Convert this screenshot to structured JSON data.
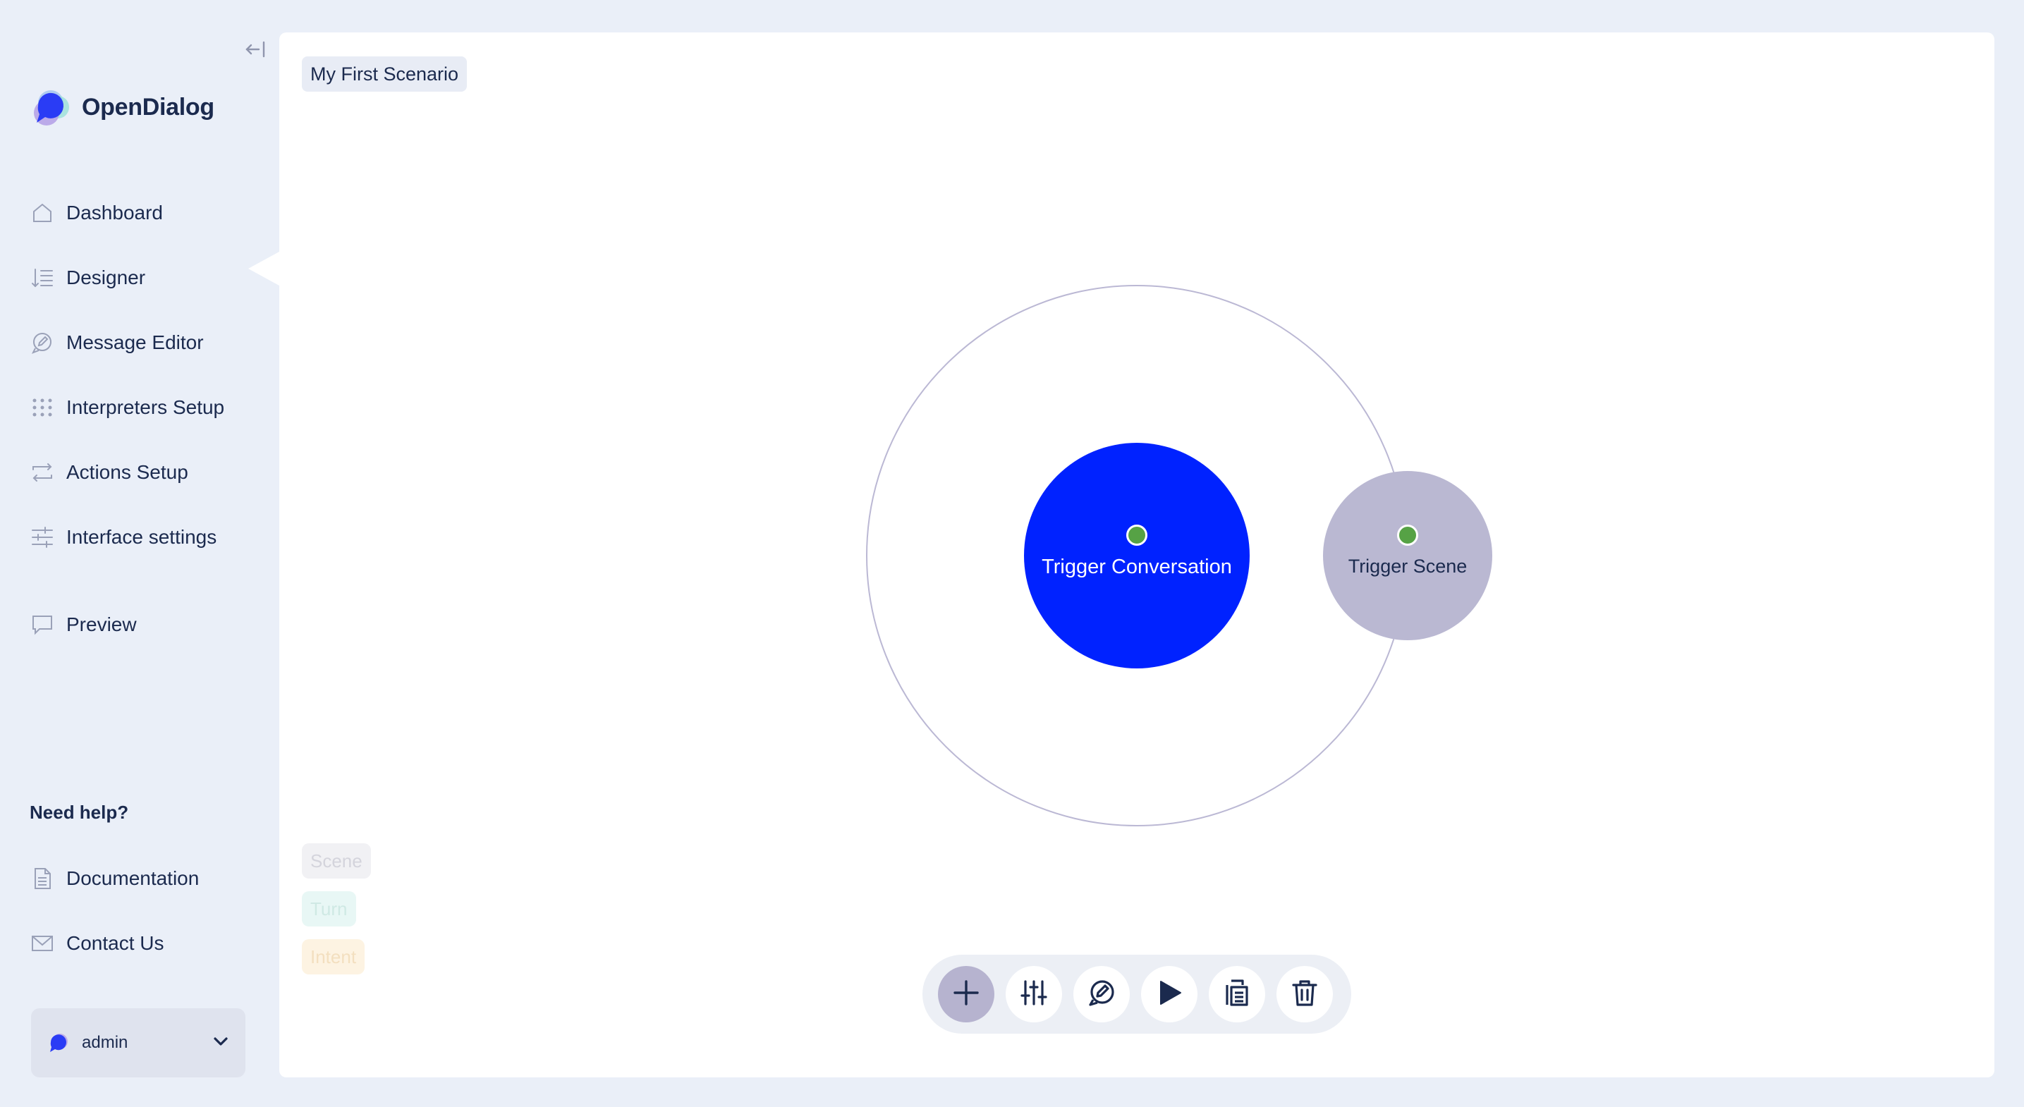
{
  "app": {
    "name": "OpenDialog"
  },
  "sidebar": {
    "items": [
      {
        "label": "Dashboard",
        "icon": "home-icon"
      },
      {
        "label": "Designer",
        "icon": "designer-icon"
      },
      {
        "label": "Message Editor",
        "icon": "message-editor-icon"
      },
      {
        "label": "Interpreters Setup",
        "icon": "grid-dots-icon"
      },
      {
        "label": "Actions Setup",
        "icon": "swap-arrows-icon"
      },
      {
        "label": "Interface settings",
        "icon": "sliders-icon"
      },
      {
        "label": "Preview",
        "icon": "chat-bubble-icon"
      }
    ],
    "active_item": "Designer",
    "help": {
      "title": "Need help?",
      "items": [
        {
          "label": "Documentation",
          "icon": "document-icon"
        },
        {
          "label": "Contact Us",
          "icon": "envelope-icon"
        }
      ]
    },
    "user": {
      "name": "admin"
    }
  },
  "canvas": {
    "scenario_name": "My First Scenario",
    "nodes": {
      "conversation": {
        "label": "Trigger Conversation",
        "color": "#0022ff"
      },
      "scene": {
        "label": "Trigger Scene",
        "color": "#bab8d2"
      }
    },
    "legend": [
      {
        "label": "Scene",
        "bg": "#f1f1f4",
        "color": "#d4d4dc"
      },
      {
        "label": "Turn",
        "bg": "#e8f7f5",
        "color": "#cfe9e4"
      },
      {
        "label": "Intent",
        "bg": "#fdf3e2",
        "color": "#f3dfbf"
      }
    ],
    "toolbar": [
      "add-icon",
      "sliders-icon",
      "message-edit-icon",
      "play-icon",
      "duplicate-icon",
      "trash-icon"
    ]
  },
  "colors": {
    "background": "#eaeff8",
    "text": "#1b2a4e",
    "accent": "#0022ff",
    "status_dot": "#56a245"
  }
}
